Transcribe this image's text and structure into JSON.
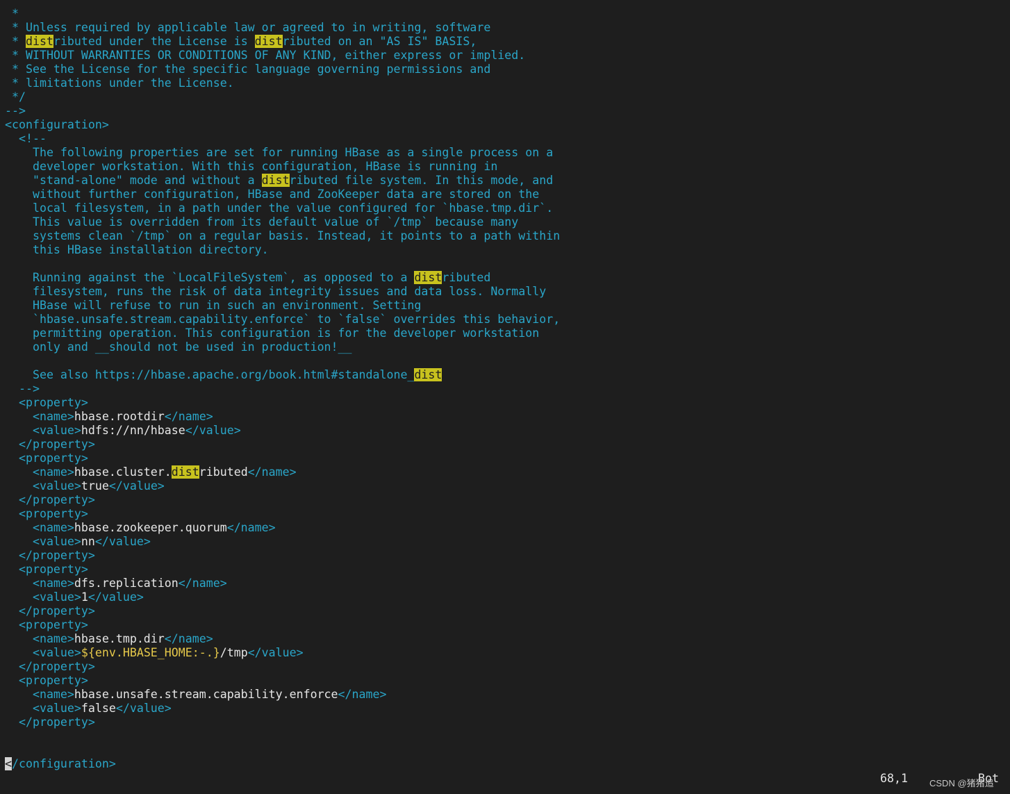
{
  "editor": {
    "lines": [
      [
        {
          "text": " *",
          "cls": "c"
        }
      ],
      [
        {
          "text": " * Unless required by applicable law or agreed to in writing, software",
          "cls": "c"
        }
      ],
      [
        {
          "text": " * ",
          "cls": "c"
        },
        {
          "text": "dist",
          "cls": "hl"
        },
        {
          "text": "ributed under the License is ",
          "cls": "c"
        },
        {
          "text": "dist",
          "cls": "hl"
        },
        {
          "text": "ributed on an \"AS IS\" BASIS,",
          "cls": "c"
        }
      ],
      [
        {
          "text": " * WITHOUT WARRANTIES OR CONDITIONS OF ANY KIND, either express or implied.",
          "cls": "c"
        }
      ],
      [
        {
          "text": " * See the License for the specific language governing permissions and",
          "cls": "c"
        }
      ],
      [
        {
          "text": " * limitations under the License.",
          "cls": "c"
        }
      ],
      [
        {
          "text": " */",
          "cls": "c"
        }
      ],
      [
        {
          "text": "-->",
          "cls": "c"
        }
      ],
      [
        {
          "text": "<configuration>",
          "cls": "t"
        }
      ],
      [
        {
          "text": "  <!--",
          "cls": "c"
        }
      ],
      [
        {
          "text": "    The following properties are set for running HBase as a single process on a",
          "cls": "c"
        }
      ],
      [
        {
          "text": "    developer workstation. With this configuration, HBase is running in",
          "cls": "c"
        }
      ],
      [
        {
          "text": "    \"stand-alone\" mode and without a ",
          "cls": "c"
        },
        {
          "text": "dist",
          "cls": "hl"
        },
        {
          "text": "ributed file system. In this mode, and",
          "cls": "c"
        }
      ],
      [
        {
          "text": "    without further configuration, HBase and ZooKeeper data are stored on the",
          "cls": "c"
        }
      ],
      [
        {
          "text": "    local filesystem, in a path under the value configured for `hbase.tmp.dir`.",
          "cls": "c"
        }
      ],
      [
        {
          "text": "    This value is overridden from its default value of `/tmp` because many",
          "cls": "c"
        }
      ],
      [
        {
          "text": "    systems clean `/tmp` on a regular basis. Instead, it points to a path within",
          "cls": "c"
        }
      ],
      [
        {
          "text": "    this HBase installation directory.",
          "cls": "c"
        }
      ],
      [
        {
          "text": "",
          "cls": "c"
        }
      ],
      [
        {
          "text": "    Running against the `LocalFileSystem`, as opposed to a ",
          "cls": "c"
        },
        {
          "text": "dist",
          "cls": "hl"
        },
        {
          "text": "ributed",
          "cls": "c"
        }
      ],
      [
        {
          "text": "    filesystem, runs the risk of data integrity issues and data loss. Normally",
          "cls": "c"
        }
      ],
      [
        {
          "text": "    HBase will refuse to run in such an environment. Setting",
          "cls": "c"
        }
      ],
      [
        {
          "text": "    `hbase.unsafe.stream.capability.enforce` to `false` overrides this behavior,",
          "cls": "c"
        }
      ],
      [
        {
          "text": "    permitting operation. This configuration is for the developer workstation",
          "cls": "c"
        }
      ],
      [
        {
          "text": "    only and __should not be used in production!__",
          "cls": "c"
        }
      ],
      [
        {
          "text": "",
          "cls": "c"
        }
      ],
      [
        {
          "text": "    See also https://hbase.apache.org/book.html#standalone_",
          "cls": "c"
        },
        {
          "text": "dist",
          "cls": "hl"
        }
      ],
      [
        {
          "text": "  -->",
          "cls": "c"
        }
      ],
      [
        {
          "text": "  <property>",
          "cls": "t"
        }
      ],
      [
        {
          "text": "    <name>",
          "cls": "t"
        },
        {
          "text": "hbase.rootdir",
          "cls": "v"
        },
        {
          "text": "</name>",
          "cls": "t"
        }
      ],
      [
        {
          "text": "    <value>",
          "cls": "t"
        },
        {
          "text": "hdfs://nn/hbase",
          "cls": "v"
        },
        {
          "text": "</value>",
          "cls": "t"
        }
      ],
      [
        {
          "text": "  </property>",
          "cls": "t"
        }
      ],
      [
        {
          "text": "  <property>",
          "cls": "t"
        }
      ],
      [
        {
          "text": "    <name>",
          "cls": "t"
        },
        {
          "text": "hbase.cluster.",
          "cls": "v"
        },
        {
          "text": "dist",
          "cls": "hl"
        },
        {
          "text": "ributed",
          "cls": "v"
        },
        {
          "text": "</name>",
          "cls": "t"
        }
      ],
      [
        {
          "text": "    <value>",
          "cls": "t"
        },
        {
          "text": "true",
          "cls": "v"
        },
        {
          "text": "</value>",
          "cls": "t"
        }
      ],
      [
        {
          "text": "  </property>",
          "cls": "t"
        }
      ],
      [
        {
          "text": "  <property>",
          "cls": "t"
        }
      ],
      [
        {
          "text": "    <name>",
          "cls": "t"
        },
        {
          "text": "hbase.zookeeper.quorum",
          "cls": "v"
        },
        {
          "text": "</name>",
          "cls": "t"
        }
      ],
      [
        {
          "text": "    <value>",
          "cls": "t"
        },
        {
          "text": "nn",
          "cls": "v"
        },
        {
          "text": "</value>",
          "cls": "t"
        }
      ],
      [
        {
          "text": "  </property>",
          "cls": "t"
        }
      ],
      [
        {
          "text": "  <property>",
          "cls": "t"
        }
      ],
      [
        {
          "text": "    <name>",
          "cls": "t"
        },
        {
          "text": "dfs.replication",
          "cls": "v"
        },
        {
          "text": "</name>",
          "cls": "t"
        }
      ],
      [
        {
          "text": "    <value>",
          "cls": "t"
        },
        {
          "text": "1",
          "cls": "v"
        },
        {
          "text": "</value>",
          "cls": "t"
        }
      ],
      [
        {
          "text": "  </property>",
          "cls": "t"
        }
      ],
      [
        {
          "text": "  <property>",
          "cls": "t"
        }
      ],
      [
        {
          "text": "    <name>",
          "cls": "t"
        },
        {
          "text": "hbase.tmp.dir",
          "cls": "v"
        },
        {
          "text": "</name>",
          "cls": "t"
        }
      ],
      [
        {
          "text": "    <value>",
          "cls": "t"
        },
        {
          "text": "${env.HBASE_HOME:-.}",
          "cls": "y"
        },
        {
          "text": "/tmp",
          "cls": "v"
        },
        {
          "text": "</value>",
          "cls": "t"
        }
      ],
      [
        {
          "text": "  </property>",
          "cls": "t"
        }
      ],
      [
        {
          "text": "  <property>",
          "cls": "t"
        }
      ],
      [
        {
          "text": "    <name>",
          "cls": "t"
        },
        {
          "text": "hbase.unsafe.stream.capability.enforce",
          "cls": "v"
        },
        {
          "text": "</name>",
          "cls": "t"
        }
      ],
      [
        {
          "text": "    <value>",
          "cls": "t"
        },
        {
          "text": "false",
          "cls": "v"
        },
        {
          "text": "</value>",
          "cls": "t"
        }
      ],
      [
        {
          "text": "  </property>",
          "cls": "t"
        }
      ],
      [
        {
          "text": "",
          "cls": "v"
        }
      ],
      [
        {
          "text": "",
          "cls": "v"
        }
      ],
      [
        {
          "text": "<",
          "cls": "cur"
        },
        {
          "text": "/configuration>",
          "cls": "t"
        }
      ]
    ]
  },
  "statusline": {
    "ruler": "68,1",
    "position": "Bot"
  },
  "watermark": "CSDN @猪猪追",
  "colors": {
    "background": "#1e1e1e",
    "comment": "#2aa6c9",
    "tag": "#2aa6c9",
    "value": "#e6e6e6",
    "variable": "#e5c84a",
    "search_highlight": "#c8c21e"
  }
}
